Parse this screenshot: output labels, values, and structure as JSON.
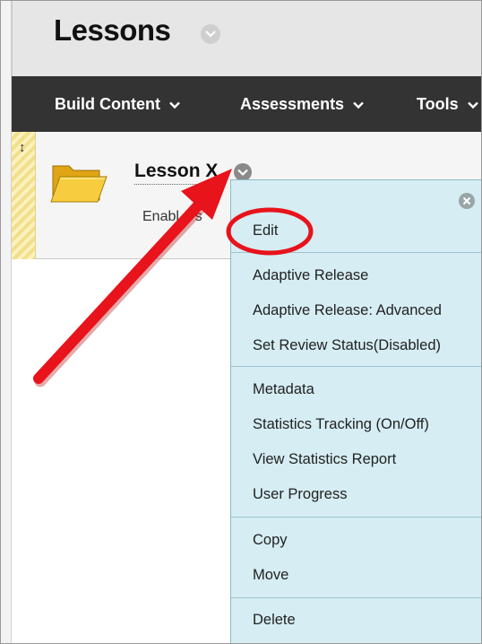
{
  "page": {
    "title": "Lessons"
  },
  "action_bar": {
    "items": [
      {
        "label": "Build Content"
      },
      {
        "label": "Assessments"
      },
      {
        "label": "Tools"
      }
    ]
  },
  "content_item": {
    "title": "Lesson X",
    "status_visible": "Enabl",
    "status_tail": "s"
  },
  "context_menu": {
    "groups": [
      [
        "Edit"
      ],
      [
        "Adaptive Release",
        "Adaptive Release: Advanced",
        "Set Review Status(Disabled)"
      ],
      [
        "Metadata",
        "Statistics Tracking (On/Off)",
        "View Statistics Report",
        "User Progress"
      ],
      [
        "Copy",
        "Move"
      ],
      [
        "Delete"
      ]
    ]
  },
  "colors": {
    "action_bar_bg": "#333333",
    "menu_bg": "#d5edf3",
    "annotation_red": "#e8131b"
  },
  "icons": [
    "chevron-down-icon",
    "close-icon",
    "folder-icon",
    "drag-handle-icon"
  ]
}
